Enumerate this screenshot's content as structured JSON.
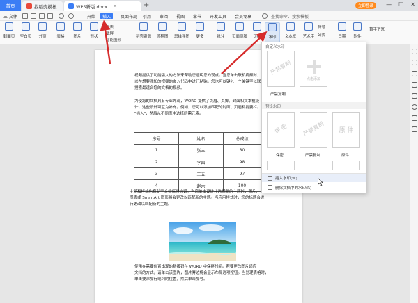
{
  "titlebar": {
    "home_tab": "首页",
    "tabs": [
      {
        "label": "找稻壳模板",
        "icon": "daoke-icon"
      },
      {
        "label": "WPS新版.docx",
        "icon": "wps-doc-icon"
      }
    ],
    "new_tab": "+",
    "login": "立即登录"
  },
  "menubar": {
    "file": "三 文件",
    "items": [
      "开始",
      "插入",
      "页面布局",
      "引用",
      "审阅",
      "视图",
      "章节",
      "开发工具",
      "会员专享"
    ],
    "active": "插入",
    "search": "查找命令、搜索模板"
  },
  "ribbon": {
    "big_buttons": [
      {
        "label": "封面页",
        "icon": "cover-page-icon"
      },
      {
        "label": "空白页",
        "icon": "blank-page-icon"
      },
      {
        "label": "分页",
        "icon": "page-break-icon"
      },
      {
        "label": "表格",
        "icon": "table-icon"
      },
      {
        "label": "图片",
        "icon": "picture-icon"
      },
      {
        "label": "形状",
        "icon": "shape-icon"
      },
      {
        "label": "稻壳资源",
        "icon": "resource-icon"
      },
      {
        "label": "流程图",
        "icon": "flowchart-icon"
      },
      {
        "label": "思维导图",
        "icon": "mindmap-icon"
      },
      {
        "label": "更多",
        "icon": "more-icon"
      },
      {
        "label": "批注",
        "icon": "comment-icon"
      },
      {
        "label": "页眉页脚",
        "icon": "header-footer-icon"
      },
      {
        "label": "页码",
        "icon": "page-number-icon"
      },
      {
        "label": "水印",
        "icon": "watermark-icon"
      },
      {
        "label": "文本框",
        "icon": "textbox-icon"
      },
      {
        "label": "艺术字",
        "icon": "wordart-icon"
      },
      {
        "label": "日期",
        "icon": "date-icon"
      },
      {
        "label": "附件",
        "icon": "attachment-icon"
      }
    ],
    "small": {
      "chart": "图表",
      "screenshot": "截屏",
      "smart": "智能图形",
      "symbol": "符号",
      "formula": "公式",
      "first_letter": "首字下沉"
    }
  },
  "document": {
    "para1": [
      "视频提供了功能强大的方法来帮助您证明您的观点。当您单击联机视频时，可",
      "以在想要添加的视频的嵌入代码中进行粘贴。您也可以键入一个关键字以联机",
      "搜索最适合您的文档的视频。"
    ],
    "para2": [
      "为使您的文档具有专业外观，WORD 提供了页眉、页脚、封面和文本框设",
      "计，这些设计可互为补充。例如，您可以添加匹配的封面、页眉和提要栏。单击",
      "\"插入\"，然后从不同库中选择所需元素。"
    ],
    "table": {
      "headers": [
        "序号",
        "姓名",
        "总成绩"
      ],
      "rows": [
        [
          "1",
          "张三",
          "80"
        ],
        [
          "2",
          "李四",
          "98"
        ],
        [
          "3",
          "王五",
          "97"
        ],
        [
          "4",
          "赵六",
          "100"
        ]
      ]
    },
    "para3": [
      "主题和样式也有助于文档保持协调。当您单击设计并选择新的主题时，图片、",
      "图表或 SmartArt 图形将会更改以匹配新的主题。当应用样式时，您的标题会进",
      "行更改以匹配新的主题。"
    ],
    "para4": [
      "使用在需要位置出现的新按钮在 WORD 中保存时间。若要更改图片适应",
      "文档的方式，请单击该图片，图片旁边将会显示布局选项按钮。当处理表格时，",
      "单击要添加行或列的位置，然后单击加号。"
    ]
  },
  "watermark_panel": {
    "custom_title": "自定义水印",
    "custom_item": "严禁复制",
    "custom_caption": "严禁复制",
    "add_label": "点击添加",
    "preset_title": "预设水印",
    "presets": [
      {
        "text": "保 密",
        "caption": "保密"
      },
      {
        "text": "严禁复制",
        "caption": "严禁复制"
      },
      {
        "text": "原 件",
        "caption": "原件"
      }
    ],
    "insert_watermark": "插入水印(W)...",
    "delete_watermark": "删除文档中的水印(R)"
  },
  "colors": {
    "accent": "#3b7df5",
    "arrow": "#d62b2b",
    "login": "#ff8a1c"
  }
}
